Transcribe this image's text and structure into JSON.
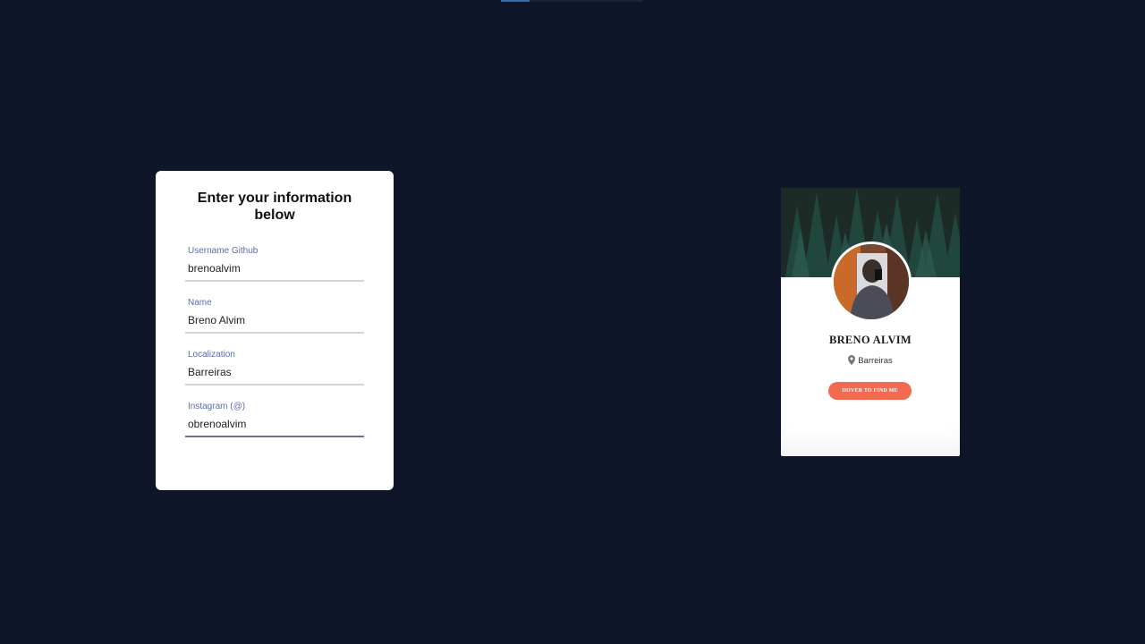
{
  "form": {
    "title": "Enter your information below",
    "fields": [
      {
        "label": "Username Github",
        "value": "brenoalvim"
      },
      {
        "label": "Name",
        "value": "Breno Alvim"
      },
      {
        "label": "Localization",
        "value": "Barreiras"
      },
      {
        "label": "Instagram (@)",
        "value": "obrenoalvim"
      }
    ]
  },
  "profile": {
    "name": "BRENO ALVIM",
    "location": "Barreiras",
    "button_label": "HOVER TO FIND ME",
    "location_icon": "map-pin-icon",
    "button_color": "#f26a4f"
  },
  "colors": {
    "background": "#0f1629",
    "label": "#5b6ba8"
  }
}
